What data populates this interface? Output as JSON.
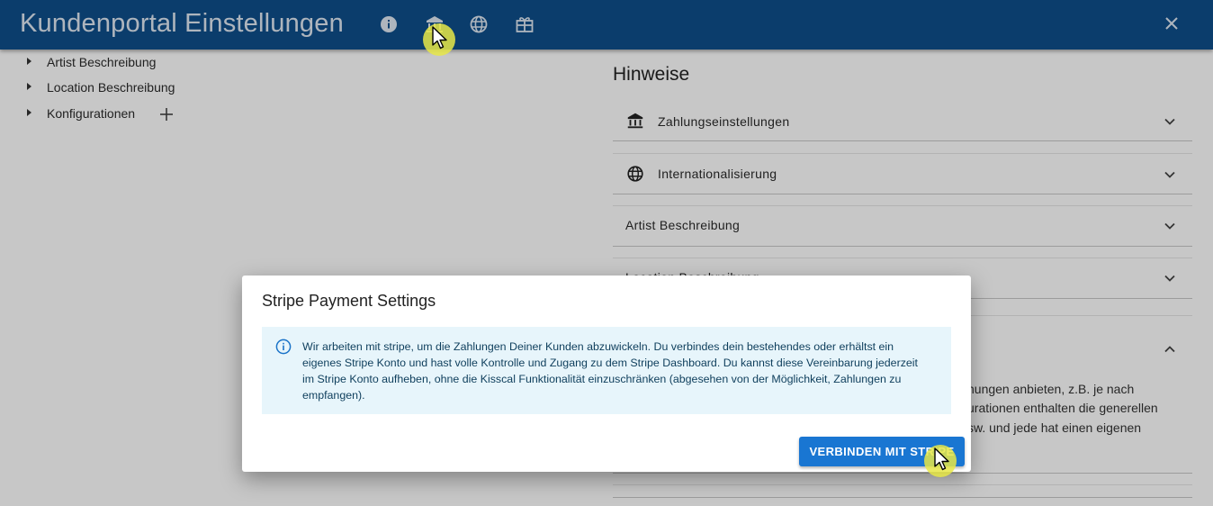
{
  "header": {
    "title": "Kundenportal Einstellungen",
    "icons": [
      "info-icon",
      "bank-icon",
      "globe-icon",
      "gift-icon"
    ],
    "close_icon": "close-icon",
    "background": "#0f4f8b"
  },
  "tree": {
    "items": [
      {
        "label": "Artist Beschreibung"
      },
      {
        "label": "Location Beschreibung"
      },
      {
        "label": "Konfigurationen"
      }
    ],
    "add_icon": "plus-icon"
  },
  "hints": {
    "heading": "Hinweise",
    "sections": [
      {
        "label": "Zahlungseinstellungen",
        "icon": "bank-icon",
        "expanded": false
      },
      {
        "label": "Internationalisierung",
        "icon": "globe-icon",
        "expanded": false
      },
      {
        "label": "Artist Beschreibung",
        "expanded": false
      },
      {
        "label": "Location Beschreibung",
        "expanded": false
      },
      {
        "label": "",
        "expanded": true
      }
    ],
    "expanded_text": [
      "hungen anbieten, z.B. je nach",
      "urationen enthalten die generellen",
      "sw. und jede hat einen eigenen"
    ]
  },
  "dialog": {
    "title": "Stripe Payment Settings",
    "info_icon": "info-icon",
    "message": "Wir arbeiten mit stripe, um die Zahlungen Deiner Kunden abzuwickeln. Du verbindes dein bestehendes oder erhältst ein eigenes Stripe Konto und hast volle Kontrolle und Zugang zu dem Stripe Dashboard. Du kannst diese Vereinbarung jederzeit im Stripe Konto aufheben, ohne die Kisscal Funktionalität einzuschränken (abgesehen von der Möglichkeit, Zahlungen zu empfangen).",
    "connect_button": "VERBINDEN MIT STRIPE",
    "button_color": "#1976d2",
    "alert_bg": "#e7f5fb"
  }
}
